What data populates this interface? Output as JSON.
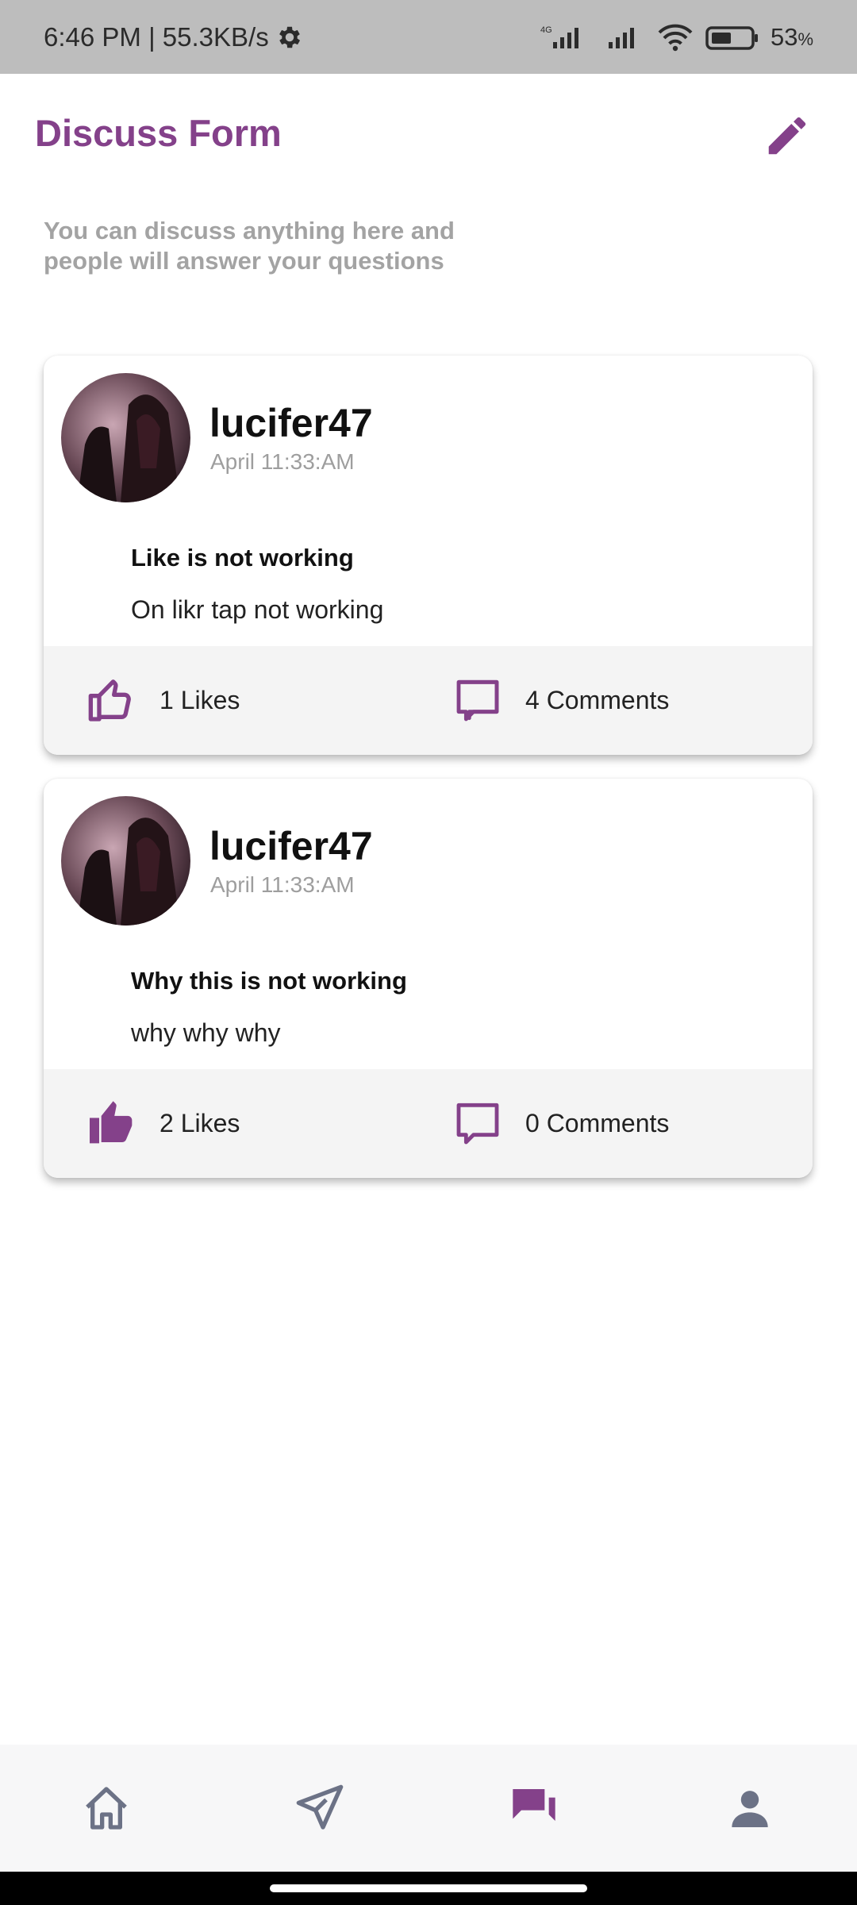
{
  "status_bar": {
    "time_speed": "6:46 PM | 55.3KB/s",
    "network_type": "4G",
    "battery": "53",
    "battery_unit": "%",
    "battery_level": 0.53,
    "icons": [
      "gear-icon",
      "signal-icon",
      "wifi-icon",
      "battery-icon"
    ]
  },
  "header": {
    "title": "Discuss Form",
    "subtitle": "You can discuss anything here and people will answer your questions",
    "edit_icon": "pencil-icon"
  },
  "posts": [
    {
      "username": "lucifer47",
      "timestamp": "April 11:33:AM",
      "title": "Like is not working",
      "body": "On likr tap not working",
      "likes_label": "1 Likes",
      "comments_label": "4 Comments",
      "liked": false
    },
    {
      "username": "lucifer47",
      "timestamp": "April 11:33:AM",
      "title": "Why this is not working",
      "body": "why why why",
      "likes_label": "2 Likes",
      "comments_label": "0 Comments",
      "liked": true
    }
  ],
  "bottom_nav": {
    "items": [
      "home-icon",
      "send-icon",
      "forum-icon",
      "person-icon"
    ],
    "active": "forum-icon"
  },
  "colors": {
    "accent": "#84418a",
    "nav_inactive": "#6c7286",
    "subtitle": "#a3a3a3",
    "footer_bg": "#f4f4f4"
  }
}
